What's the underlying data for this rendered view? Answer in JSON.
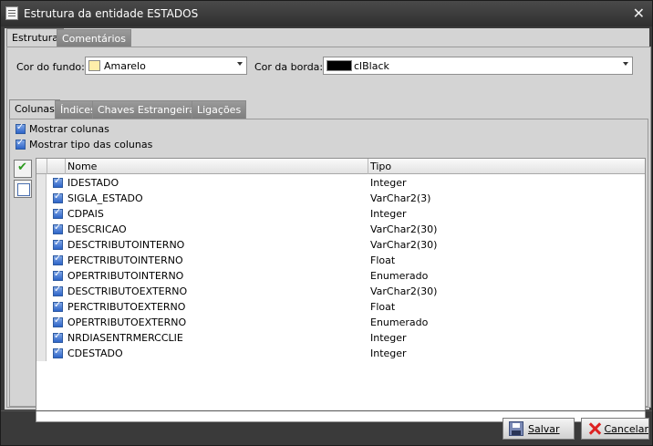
{
  "window": {
    "title": "Estrutura da entidade ESTADOS"
  },
  "main_tabs": [
    "Estrutura",
    "Comentários"
  ],
  "cor_fundo": {
    "label": "Cor do fundo:",
    "value": "Amarelo",
    "color": "#ffeeaa"
  },
  "cor_borda": {
    "label": "Cor da borda:",
    "value": "clBlack",
    "color": "#000000"
  },
  "sub_tabs": [
    "Colunas",
    "Índices",
    "Chaves Estrangeiras",
    "Ligações"
  ],
  "options": {
    "mostrar_colunas": "Mostrar colunas",
    "mostrar_tipo": "Mostrar tipo das colunas"
  },
  "grid": {
    "headers": {
      "nome": "Nome",
      "tipo": "Tipo"
    },
    "rows": [
      {
        "nome": "IDESTADO",
        "tipo": "Integer"
      },
      {
        "nome": "SIGLA_ESTADO",
        "tipo": "VarChar2(3)"
      },
      {
        "nome": "CDPAIS",
        "tipo": "Integer"
      },
      {
        "nome": "DESCRICAO",
        "tipo": "VarChar2(30)"
      },
      {
        "nome": "DESCTRIBUTOINTERNO",
        "tipo": "VarChar2(30)"
      },
      {
        "nome": "PERCTRIBUTOINTERNO",
        "tipo": "Float"
      },
      {
        "nome": "OPERTRIBUTOINTERNO",
        "tipo": "Enumerado"
      },
      {
        "nome": "DESCTRIBUTOEXTERNO",
        "tipo": "VarChar2(30)"
      },
      {
        "nome": "PERCTRIBUTOEXTERNO",
        "tipo": "Float"
      },
      {
        "nome": "OPERTRIBUTOEXTERNO",
        "tipo": "Enumerado"
      },
      {
        "nome": "NRDIASENTRMERCCLIE",
        "tipo": "Integer"
      },
      {
        "nome": "CDESTADO",
        "tipo": "Integer"
      }
    ]
  },
  "buttons": {
    "salvar": "Salvar",
    "cancelar": "Cancelar"
  }
}
